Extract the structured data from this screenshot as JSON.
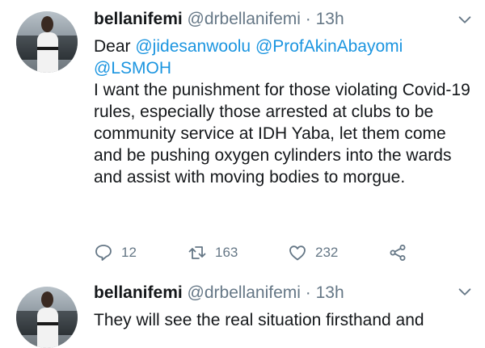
{
  "tweets": [
    {
      "name": "bellanifemi",
      "handle": "@drbellanifemi",
      "separator": "·",
      "time": "13h",
      "greeting": "Dear ",
      "mentions": [
        "@jidesanwoolu",
        "@ProfAkinAbayomi",
        "@LSMOH"
      ],
      "body": "I want the punishment for those violating Covid-19 rules, especially those arrested at clubs to be community service at IDH Yaba, let them come and be pushing oxygen cylinders into the wards and assist with moving bodies to morgue.",
      "replies": "12",
      "retweets": "163",
      "likes": "232"
    },
    {
      "name": "bellanifemi",
      "handle": "@drbellanifemi",
      "separator": "·",
      "time": "13h",
      "body": "They will see the real situation firsthand and"
    }
  ],
  "icons": {
    "reply": "reply-icon",
    "retweet": "retweet-icon",
    "like": "heart-icon",
    "share": "share-icon",
    "caret": "chevron-down-icon"
  },
  "colors": {
    "link": "#1b95e0",
    "muted": "#657786",
    "text": "#14171a"
  }
}
